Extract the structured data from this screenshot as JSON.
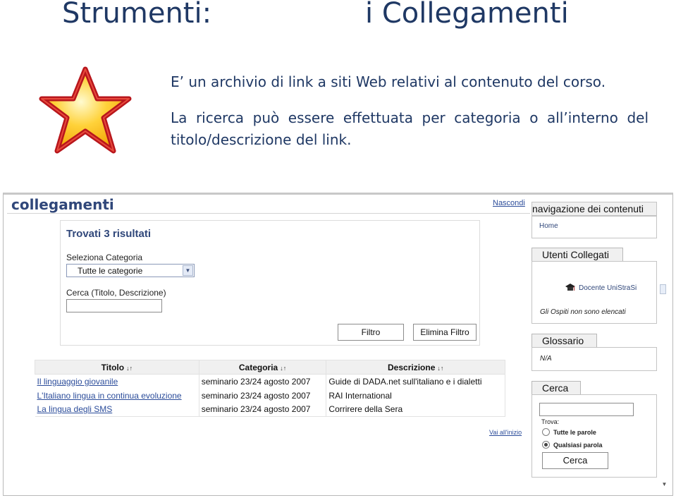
{
  "slide": {
    "title_left": "Strumenti:",
    "title_right": "i Collegamenti",
    "paragraph1": "E’ un archivio di link a siti Web relativi al contenuto del corso.",
    "paragraph2": "La ricerca può essere effettuata per categoria o all’interno del titolo/descrizione del link.",
    "icon": "star-icon"
  },
  "app": {
    "title": "collegamenti",
    "hide_link": "Nascondi",
    "results_heading": "Trovati 3 risultati",
    "category_label": "Seleziona Categoria",
    "category_selected": "Tutte le categorie",
    "search_label": "Cerca (Titolo, Descrizione)",
    "search_value": "",
    "filter_button": "Filtro",
    "clear_filter_button": "Elimina Filtro",
    "back_to_top": "Vai all'inizio"
  },
  "table": {
    "columns": [
      "Titolo",
      "Categoria",
      "Descrizione"
    ],
    "sort_glyph": "↓↑",
    "rows": [
      {
        "title": "Il linguaggio giovanile",
        "category": "seminario 23/24 agosto 2007",
        "description": "Guide di DADA.net sull'italiano e i dialetti"
      },
      {
        "title": "L'Italiano lingua in continua evoluzione",
        "category": "seminario 23/24 agosto 2007",
        "description": "RAI International"
      },
      {
        "title": "La lingua degli SMS",
        "category": "seminario 23/24 agosto 2007",
        "description": "Corrirere della Sera"
      }
    ]
  },
  "sidebar": {
    "nav_header": "navigazione dei contenuti",
    "home": "Home",
    "online_tab": "Utenti Collegati",
    "online_user": "Docente UniStraSi",
    "guests_note": "Gli Ospiti non sono elencati",
    "glossary_tab": "Glossario",
    "glossary_value": "N/A",
    "search_tab": "Cerca",
    "search_value": "",
    "find_label": "Trova:",
    "options": [
      {
        "label": "Tutte le parole",
        "selected": false
      },
      {
        "label": "Qualsiasi parola",
        "selected": true
      }
    ],
    "search_button": "Cerca"
  },
  "colors": {
    "title_blue": "#1f3864",
    "app_heading": "#30477a",
    "link": "#2b4c9a",
    "header_bg": "#f0f0f0"
  }
}
